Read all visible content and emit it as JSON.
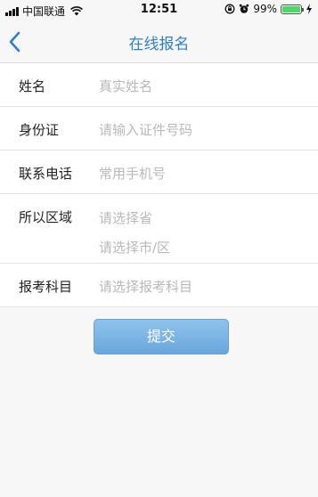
{
  "status_bar": {
    "carrier": "中国联通",
    "time": "12:51",
    "battery_percent": "99%",
    "battery_level": 0.99,
    "icons": [
      "signal-icon",
      "wifi-icon",
      "rotation-lock-icon",
      "alarm-icon",
      "battery-icon",
      "charging-icon"
    ]
  },
  "nav": {
    "title": "在线报名",
    "back_icon": "chevron-left-icon",
    "accent_color": "#2f7fce"
  },
  "form": {
    "name": {
      "label": "姓名",
      "placeholder": "真实姓名"
    },
    "id_card": {
      "label": "身份证",
      "placeholder": "请输入证件号码"
    },
    "phone": {
      "label": "联系电话",
      "placeholder": "常用手机号"
    },
    "region": {
      "label": "所以区域",
      "province_placeholder": "请选择省",
      "city_placeholder": "请选择市/区"
    },
    "subject": {
      "label": "报考科目",
      "placeholder": "请选择报考科目"
    }
  },
  "submit_label": "提交"
}
